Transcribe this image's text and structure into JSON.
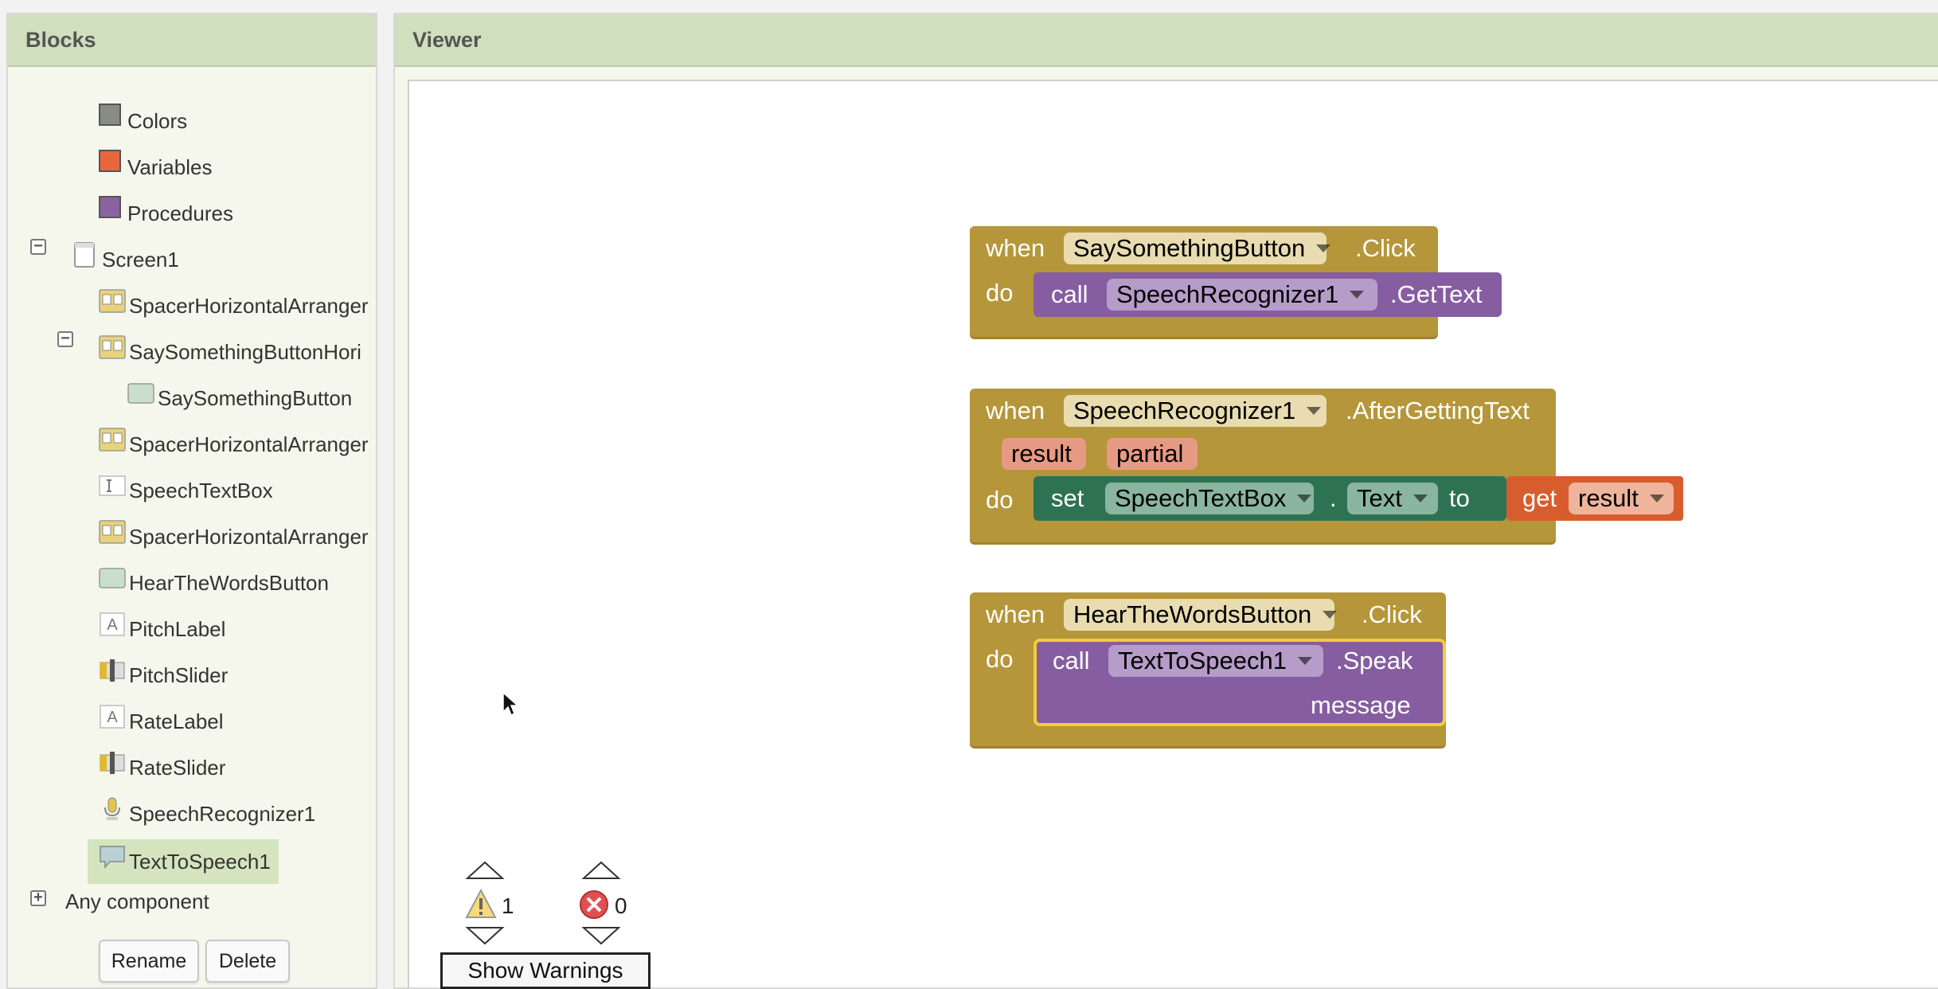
{
  "blocks_panel": {
    "title": "Blocks",
    "items": [
      {
        "label": "Colors",
        "icon": "color-swatch-icon",
        "color": "#888c84"
      },
      {
        "label": "Variables",
        "icon": "variables-swatch-icon",
        "color": "#e8663c"
      },
      {
        "label": "Procedures",
        "icon": "procedures-swatch-icon",
        "color": "#8a62a0"
      },
      {
        "label": "Screen1",
        "icon": "screen-icon",
        "toggle": "−"
      },
      {
        "label": "SpacerHorizontalArranger",
        "icon": "horizontal-arrangement-icon"
      },
      {
        "label": "SaySomethingButtonHori",
        "icon": "horizontal-arrangement-icon",
        "toggle": "−"
      },
      {
        "label": "SaySomethingButton",
        "icon": "button-icon"
      },
      {
        "label": "SpacerHorizontalArranger",
        "icon": "horizontal-arrangement-icon"
      },
      {
        "label": "SpeechTextBox",
        "icon": "textbox-icon"
      },
      {
        "label": "SpacerHorizontalArranger",
        "icon": "horizontal-arrangement-icon"
      },
      {
        "label": "HearTheWordsButton",
        "icon": "button-icon"
      },
      {
        "label": "PitchLabel",
        "icon": "label-icon"
      },
      {
        "label": "PitchSlider",
        "icon": "slider-icon"
      },
      {
        "label": "RateLabel",
        "icon": "label-icon"
      },
      {
        "label": "RateSlider",
        "icon": "slider-icon"
      },
      {
        "label": "SpeechRecognizer1",
        "icon": "microphone-icon"
      },
      {
        "label": "TextToSpeech1",
        "icon": "speech-bubble-icon"
      }
    ],
    "any_component": {
      "label": "Any component",
      "toggle": "+"
    },
    "rename_label": "Rename",
    "delete_label": "Delete"
  },
  "viewer": {
    "title": "Viewer",
    "blocks": {
      "b1": {
        "when": "when",
        "component": "SaySomethingButton",
        "event": ".Click",
        "do": "do",
        "call": "call",
        "target": "SpeechRecognizer1",
        "method": ".GetText"
      },
      "b2": {
        "when": "when",
        "component": "SpeechRecognizer1",
        "event": ".AfterGettingText",
        "param1": "result",
        "param2": "partial",
        "do": "do",
        "set": "set",
        "target": "SpeechTextBox",
        "dot": ".",
        "property": "Text",
        "to": "to",
        "get": "get",
        "var": "result"
      },
      "b3": {
        "when": "when",
        "component": "HearTheWordsButton",
        "event": ".Click",
        "do": "do",
        "call": "call",
        "target": "TextToSpeech1",
        "method": ".Speak",
        "arg": "message"
      }
    },
    "warnings_count": "1",
    "errors_count": "0",
    "show_warnings_label": "Show Warnings"
  },
  "colors": {
    "event_block": "#b5963a",
    "procedure_block": "#865da1",
    "setter_block": "#2e7351",
    "variable_block": "#d85d2e",
    "header_green": "#d0dfbd",
    "selected_item": "#d4e4bf"
  }
}
